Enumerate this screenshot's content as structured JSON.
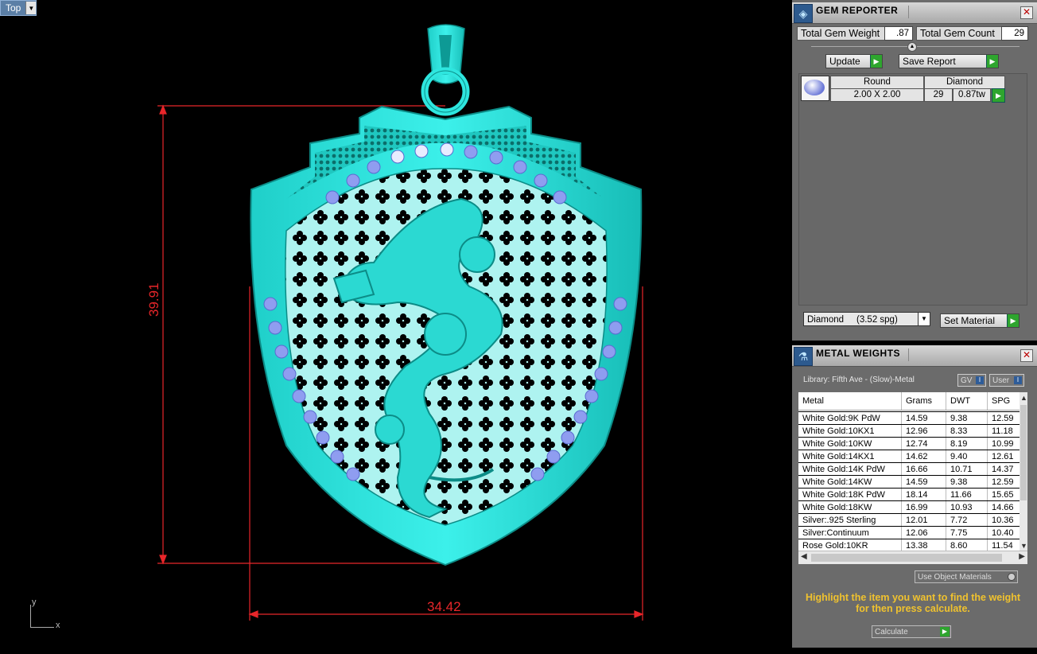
{
  "viewport": {
    "view_name": "Top",
    "dim_height": "39.91",
    "dim_width": "34.42",
    "axis_y": "y",
    "axis_x": "x"
  },
  "gem_reporter": {
    "title": "GEM REPORTER",
    "total_weight_label": "Total Gem Weight",
    "total_weight_value": ".87",
    "total_count_label": "Total Gem Count",
    "total_count_value": "29",
    "update_label": "Update",
    "save_report_label": "Save Report",
    "gem_row": {
      "shape": "Round",
      "material": "Diamond",
      "size": "2.00 X 2.00",
      "count": "29",
      "weight": "0.87tw"
    },
    "material_select": "Diamond     (3.52 spg)",
    "set_material_label": "Set Material"
  },
  "metal_weights": {
    "title": "METAL WEIGHTS",
    "library": "Library: Fifth Ave - (Slow)-Metal",
    "gv_label": "GV",
    "user_label": "User",
    "columns": [
      "Metal",
      "Grams",
      "DWT",
      "SPG"
    ],
    "rows": [
      [
        "White Gold:9K PdW",
        "14.59",
        "9.38",
        "12.59"
      ],
      [
        "White Gold:10KX1",
        "12.96",
        "8.33",
        "11.18"
      ],
      [
        "White Gold:10KW",
        "12.74",
        "8.19",
        "10.99"
      ],
      [
        "White Gold:14KX1",
        "14.62",
        "9.40",
        "12.61"
      ],
      [
        "White Gold:14K PdW",
        "16.66",
        "10.71",
        "14.37"
      ],
      [
        "White Gold:14KW",
        "14.59",
        "9.38",
        "12.59"
      ],
      [
        "White Gold:18K PdW",
        "18.14",
        "11.66",
        "15.65"
      ],
      [
        "White Gold:18KW",
        "16.99",
        "10.93",
        "14.66"
      ],
      [
        "Silver:.925 Sterling",
        "12.01",
        "7.72",
        "10.36"
      ],
      [
        "Silver:Continuum",
        "12.06",
        "7.75",
        "10.40"
      ],
      [
        "Rose Gold:10KR",
        "13.38",
        "8.60",
        "11.54"
      ]
    ],
    "use_object_materials": "Use Object Materials",
    "hint": "Highlight the item you want to find the weight for then press calculate.",
    "calculate_label": "Calculate"
  },
  "colors": {
    "model": "#2ee6df",
    "dimension": "#e8262a",
    "gem": "#8f9df0",
    "hint": "#f0c22e"
  }
}
